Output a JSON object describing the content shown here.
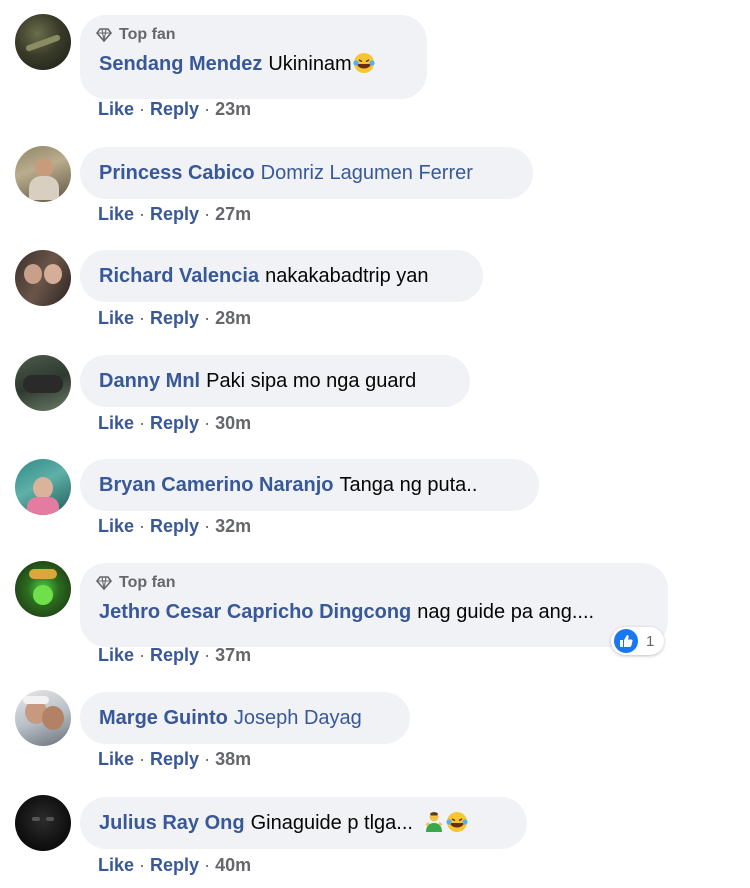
{
  "actions": {
    "like": "Like",
    "reply": "Reply",
    "separator": "·"
  },
  "badge": {
    "label": "Top fan",
    "icon": "diamond-icon"
  },
  "comments": [
    {
      "author": "Sendang Mendez",
      "text": "Ukininam",
      "emoji": "laughing-tears-icon",
      "top_fan": true,
      "time": "23m"
    },
    {
      "author": "Princess Cabico",
      "mention": "Domriz Lagumen Ferrer",
      "top_fan": false,
      "time": "27m"
    },
    {
      "author": "Richard Valencia",
      "text": "nakakabadtrip yan",
      "top_fan": false,
      "time": "28m"
    },
    {
      "author": "Danny Mnl",
      "text": "Paki sipa mo nga guard",
      "top_fan": false,
      "time": "30m"
    },
    {
      "author": "Bryan Camerino Naranjo",
      "text": "Tanga ng puta..",
      "top_fan": false,
      "time": "32m"
    },
    {
      "author": "Jethro Cesar Capricho Dingcong",
      "text": "nag guide pa ang....",
      "top_fan": true,
      "time": "37m",
      "reaction": {
        "icon": "thumbs-up-icon",
        "count": "1"
      }
    },
    {
      "author": "Marge Guinto",
      "mention": "Joseph Dayag",
      "top_fan": false,
      "time": "38m"
    },
    {
      "author": "Julius Ray Ong",
      "text": "Ginaguide p tlga...",
      "emoji_list": [
        "man-gesturing-icon",
        "laughing-tears-icon"
      ],
      "top_fan": false,
      "time": "40m"
    }
  ],
  "colors": {
    "name": "#385898",
    "bubble": "#f0f2f5",
    "meta": "#65676b",
    "reaction": "#1877f2"
  }
}
